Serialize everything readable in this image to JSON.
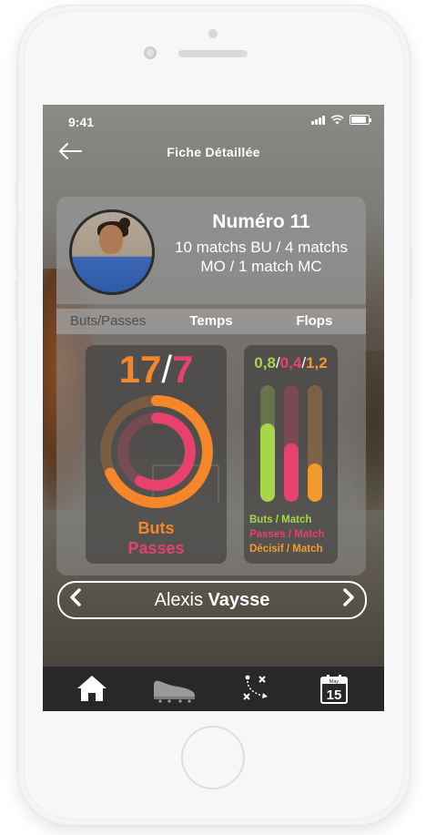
{
  "status": {
    "time": "9:41"
  },
  "nav": {
    "title": "Fiche Détaillée",
    "back_icon": "arrow-left-icon"
  },
  "profile": {
    "title": "Numéro 11",
    "matches_line1": "10 matchs BU / 4 matchs",
    "matches_line2": "MO / 1 match MC"
  },
  "tabs": [
    {
      "label": "Buts/Passes",
      "active": true
    },
    {
      "label": "Temps",
      "active": false
    },
    {
      "label": "Flops",
      "active": false
    }
  ],
  "stats": {
    "goals": "17",
    "separator": "/",
    "assists": "7",
    "legend_goals": "Buts",
    "legend_assists": "Passes",
    "goals_ring_fraction": 0.68,
    "assists_ring_fraction": 0.58
  },
  "ratios": {
    "goals_per_match": "0,8",
    "assists_per_match": "0,4",
    "decisive_per_match": "1,2",
    "sep1": "/",
    "sep2": "/",
    "goals_bar_fraction": 0.67,
    "assists_bar_fraction": 0.5,
    "decisive_bar_fraction": 0.33,
    "legend_goals": "Buts / Match",
    "legend_assists": "Passes / Match",
    "legend_decisive": "Décisif / Match"
  },
  "player": {
    "first_name": "Alexis",
    "last_name": "Vaysse"
  },
  "tabbar": {
    "items": [
      "home-icon",
      "football-boot-icon",
      "tactics-board-icon",
      "calendar-icon"
    ],
    "calendar_month": "May",
    "calendar_day": "15"
  },
  "colors": {
    "goals": "#f5862a",
    "assists": "#e7426d",
    "ratio_goals": "#a8d64a",
    "ratio_decisive": "#f29a2e"
  }
}
